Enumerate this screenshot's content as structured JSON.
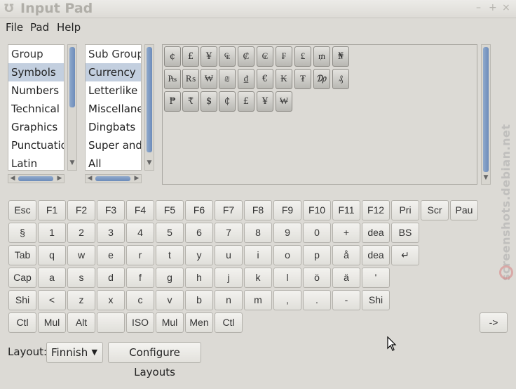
{
  "window": {
    "title": "Input Pad",
    "icon": "ui-logo-icon",
    "controls": [
      "–",
      "+",
      "×"
    ]
  },
  "menu": [
    "File",
    "Pad",
    "Help"
  ],
  "group_list": {
    "header": "Group",
    "items": [
      "Symbols",
      "Numbers",
      "Technical",
      "Graphics",
      "Punctuation",
      "Latin"
    ],
    "selected": "Symbols"
  },
  "subgroup_list": {
    "header": "Sub Group",
    "items": [
      "Currency",
      "Letterlike",
      "Miscellaneous",
      "Dingbats",
      "Super and Subscripts",
      "All"
    ],
    "selected": "Currency"
  },
  "char_grid": [
    [
      "¢",
      "£",
      "¥",
      "₠",
      "₡",
      "₢",
      "₣",
      "₤",
      "₥",
      "₦"
    ],
    [
      "₧",
      "₨",
      "₩",
      "₪",
      "₫",
      "€",
      "₭",
      "₮",
      "₯",
      "₰"
    ],
    [
      "₱",
      "₹",
      "$",
      "₵",
      "£",
      "¥",
      "₩"
    ]
  ],
  "keyboard": [
    [
      "Esc",
      "F1",
      "F2",
      "F3",
      "F4",
      "F5",
      "F6",
      "F7",
      "F8",
      "F9",
      "F10",
      "F11",
      "F12",
      "Pri",
      "Scr",
      "Pau"
    ],
    [
      "§",
      "1",
      "2",
      "3",
      "4",
      "5",
      "6",
      "7",
      "8",
      "9",
      "0",
      "+",
      "dea",
      "BS"
    ],
    [
      "Tab",
      "q",
      "w",
      "e",
      "r",
      "t",
      "y",
      "u",
      "i",
      "o",
      "p",
      "å",
      "dea",
      "↵"
    ],
    [
      "Cap",
      "a",
      "s",
      "d",
      "f",
      "g",
      "h",
      "j",
      "k",
      "l",
      "ö",
      "ä",
      "'"
    ],
    [
      "Shi",
      "<",
      "z",
      "x",
      "c",
      "v",
      "b",
      "n",
      "m",
      ",",
      ".",
      "-",
      "Shi"
    ],
    [
      "Ctl",
      "Mul",
      "Alt",
      "",
      "ISO",
      "Mul",
      "Men",
      "Ctl"
    ]
  ],
  "arrow_button": "->",
  "layout": {
    "label": "Layout:",
    "value": "Finnish",
    "configure": "Configure Layouts"
  },
  "watermark": "screenshots.debian.net"
}
